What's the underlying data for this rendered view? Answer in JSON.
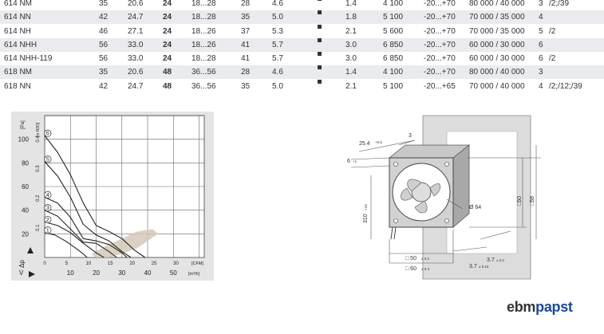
{
  "table": {
    "rows": [
      {
        "model": "614 NM",
        "c1": "35",
        "c2": "20.6",
        "c3": "24",
        "c4": "18...28",
        "c5": "28",
        "c6": "4.6",
        "c7": "1.4",
        "c8": "4 100",
        "c9": "-20...+70",
        "c10": "80 000 / 40 000",
        "c11": "3",
        "c12": "/2;/39"
      },
      {
        "model": "614 NN",
        "c1": "42",
        "c2": "24.7",
        "c3": "24",
        "c4": "18...28",
        "c5": "35",
        "c6": "5.0",
        "c7": "1.8",
        "c8": "5 100",
        "c9": "-20...+70",
        "c10": "70 000 / 35 000",
        "c11": "4",
        "c12": ""
      },
      {
        "model": "614 NH",
        "c1": "46",
        "c2": "27.1",
        "c3": "24",
        "c4": "18...26",
        "c5": "37",
        "c6": "5.3",
        "c7": "2.1",
        "c8": "5 600",
        "c9": "-20...+70",
        "c10": "70 000 / 35 000",
        "c11": "5",
        "c12": "/2"
      },
      {
        "model": "614 NHH",
        "c1": "56",
        "c2": "33.0",
        "c3": "24",
        "c4": "18...26",
        "c5": "41",
        "c6": "5.7",
        "c7": "3.0",
        "c8": "6 850",
        "c9": "-20...+70",
        "c10": "60 000 / 30 000",
        "c11": "6",
        "c12": ""
      },
      {
        "model": "614 NHH-119",
        "c1": "56",
        "c2": "33.0",
        "c3": "24",
        "c4": "18...28",
        "c5": "41",
        "c6": "5.7",
        "c7": "3.0",
        "c8": "6 850",
        "c9": "-20...+70",
        "c10": "60 000 / 30 000",
        "c11": "6",
        "c12": "/2"
      },
      {
        "model": "618 NM",
        "c1": "35",
        "c2": "20.6",
        "c3": "48",
        "c4": "36...56",
        "c5": "28",
        "c6": "4.6",
        "c7": "1.4",
        "c8": "4 100",
        "c9": "-20...+70",
        "c10": "80 000 / 40 000",
        "c11": "3",
        "c12": ""
      },
      {
        "model": "618 NN",
        "c1": "42",
        "c2": "24.7",
        "c3": "48",
        "c4": "36...56",
        "c5": "35",
        "c6": "5.0",
        "c7": "2.1",
        "c8": "5 100",
        "c9": "-20...+65",
        "c10": "70 000 / 40 000",
        "c11": "4",
        "c12": "/2;/12;/39"
      }
    ]
  },
  "chart_data": {
    "type": "line",
    "ylabel": "Δp",
    "y_unit_primary": "[Pa]",
    "y_unit_secondary": "[in H2O]",
    "x_unit_primary": "[CFM]",
    "x_unit_secondary": "[m³/h]",
    "xlabel": "V̇",
    "y_ticks_pa": [
      "20",
      "40",
      "60",
      "80",
      "100"
    ],
    "y_ticks_inh2o": [
      "0.1",
      "0.2",
      "0.3",
      "0.4"
    ],
    "x_ticks_cfm": [
      "0",
      "5",
      "10",
      "15",
      "20",
      "25",
      "30"
    ],
    "x_ticks_m3h": [
      "10",
      "20",
      "30",
      "40",
      "50"
    ],
    "xlim_m3h": [
      0,
      62
    ],
    "ylim_pa": [
      0,
      120
    ],
    "series": [
      {
        "name": "1",
        "x": [
          0,
          4,
          8,
          12,
          15,
          16.5
        ],
        "y": [
          21,
          19,
          14,
          8,
          3,
          0
        ]
      },
      {
        "name": "2",
        "x": [
          0,
          5,
          10,
          15,
          20,
          23
        ],
        "y": [
          30,
          27,
          21,
          12,
          4,
          0
        ]
      },
      {
        "name": "3",
        "x": [
          0,
          5,
          10,
          15,
          20,
          25,
          28
        ],
        "y": [
          40,
          35,
          24,
          13,
          12,
          5,
          0
        ]
      },
      {
        "name": "4",
        "x": [
          0,
          5,
          10,
          15,
          20,
          25,
          30,
          32
        ],
        "y": [
          51,
          46,
          34,
          16,
          14,
          11,
          4,
          0
        ]
      },
      {
        "name": "5",
        "x": [
          0,
          5,
          10,
          15,
          20,
          25,
          30,
          33.5
        ],
        "y": [
          81,
          69,
          51,
          28,
          19,
          14,
          5,
          0
        ]
      },
      {
        "name": "6",
        "x": [
          0,
          5,
          10,
          15,
          20,
          25,
          30,
          35,
          39
        ],
        "y": [
          103,
          89,
          70,
          46,
          27,
          22,
          16,
          6,
          0
        ]
      }
    ],
    "labels": [
      "1",
      "2",
      "3",
      "4",
      "5",
      "6"
    ]
  },
  "drawing": {
    "dim_254": "25.4",
    "dim_254_tol": "+0.5",
    "dim_3": "3",
    "dim_6": "6",
    "dim_6_tol": "+1",
    "dim_310": "310",
    "dim_310_tol": "+10",
    "dim_64": "Ø 64",
    "dim_50v": "□50",
    "dim_58": "□58",
    "dim_50h": "□ 50",
    "dim_50h_tol": "± 0.2",
    "dim_60": "□ 60",
    "dim_60_tol": "± 0.3",
    "dim_37a": "3.7",
    "dim_37a_tol": "± 0.2",
    "dim_37b": "3.7",
    "dim_37b_tol": "± 0.15"
  },
  "brand": {
    "part1": "ebm",
    "part2": "papst"
  }
}
